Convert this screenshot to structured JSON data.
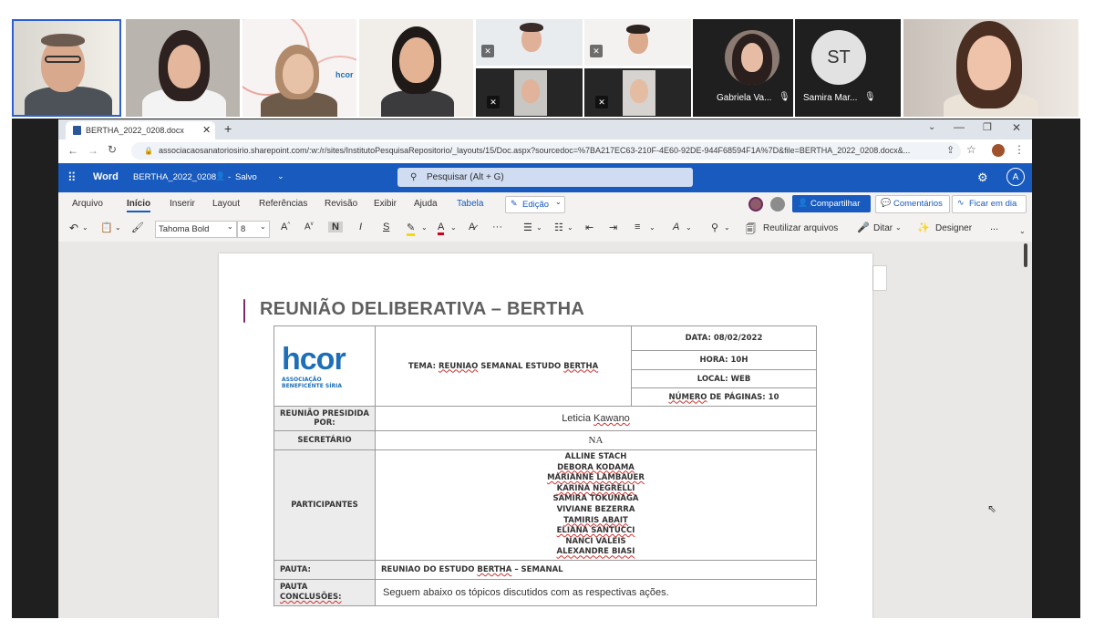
{
  "meeting": {
    "participants": [
      {
        "name": "Gabriela Va...",
        "muted": true
      },
      {
        "name": "Samira Mar...",
        "initials": "ST",
        "muted": true
      }
    ]
  },
  "browser": {
    "tab_title": "BERTHA_2022_0208.docx",
    "new_tab": "+",
    "url": "associacaosanatoriosirio.sharepoint.com/:w:/r/sites/InstitutoPesquisaRepositorio/_layouts/15/Doc.aspx?sourcedoc=%7BA217EC63-210F-4E60-92DE-944F68594F1A%7D&file=BERTHA_2022_0208.docx&..."
  },
  "word": {
    "app_name": "Word",
    "doc_name": "BERTHA_2022_0208",
    "save_status": "Salvo",
    "search_placeholder": "Pesquisar (Alt + G)",
    "account_initial": "A",
    "menu": [
      "Arquivo",
      "Início",
      "Inserir",
      "Layout",
      "Referências",
      "Revisão",
      "Exibir",
      "Ajuda",
      "Tabela"
    ],
    "editing_mode": "Edição",
    "share_label": "Compartilhar",
    "comments_label": "Comentários",
    "catchup_label": "Ficar em dia",
    "font_name": "Tahoma Bold",
    "font_size": "8",
    "reuse_files": "Reutilizar arquivos",
    "dictate": "Ditar",
    "designer": "Designer",
    "more": "..."
  },
  "document": {
    "title": "REUNIÃO DELIBERATIVA – BERTHA",
    "logo_text": "hcor",
    "logo_sub1": "ASSOCIAÇÃO",
    "logo_sub2": "BENEFICENTE SÍRIA",
    "tema_prefix": "TEMA: ",
    "tema_underlined": "REUNIAO",
    "tema_middle": " SEMANAL ESTUDO ",
    "tema_bertha": "BERTHA",
    "data": "DATA: 08/02/2022",
    "hora": "HORA: 10H",
    "local": "LOCAL: WEB",
    "paginas_underlined": "NÚMERO",
    "paginas_rest": " DE PÁGINAS: 10",
    "presidida_label": "REUNIÃO PRESIDIDA POR:",
    "presidida_first": "Leticia ",
    "presidida_last": "Kawano",
    "secretario_label": "SECRETÁRIO",
    "secretario_value": "NA",
    "participantes_label": "PARTICIPANTES",
    "participantes": [
      {
        "text": "ALLINE STACH",
        "squig": false
      },
      {
        "text": "DEBORA KODAMA",
        "squig": true
      },
      {
        "text": "MARIANNE LAMBAUER",
        "squig": true
      },
      {
        "text": "KARINA NEGRELLI",
        "squig": true
      },
      {
        "text": "SAMIRA TOKUNAGA",
        "squig": false
      },
      {
        "text": "VIVIANE BEZERRA",
        "squig": false
      },
      {
        "text": "TAMIRIS ABAIT",
        "squig": true
      },
      {
        "text": "ELIANA SANTUCCI",
        "squig": true
      },
      {
        "text": "NANCI VALEIS",
        "squig": false
      },
      {
        "text": "ALEXANDRE BIASI",
        "squig": true
      }
    ],
    "pauta_label": "PAUTA:",
    "pauta_prefix": "REUNIAO DO ESTUDO ",
    "pauta_bertha": "BERTHA",
    "pauta_suffix": " – SEMANAL",
    "conclusoes_label1": "PAUTA",
    "conclusoes_label2": "CONCLUSÕES:",
    "conclusoes_value": "Seguem abaixo os tópicos discutidos com as respectivas ações."
  },
  "colors": {
    "word_blue": "#185abd",
    "hcor_blue": "#1e6fb8",
    "tab_accent": "#2b579a"
  }
}
